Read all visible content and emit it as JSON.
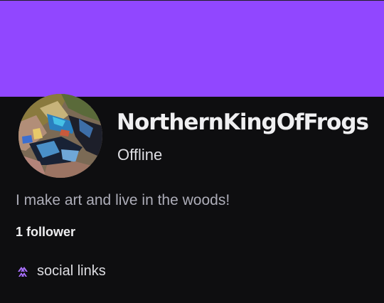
{
  "profile": {
    "username": "NorthernKingOfFrogs",
    "status": "Offline",
    "bio": "I make art and live in the woods!",
    "followers": "1 follower",
    "social_links_label": "social links",
    "avatar_icon": "profile-avatar-artwork",
    "social_icon": "double-chevron-up-icon"
  },
  "colors": {
    "banner": "#9147ff",
    "background": "#0e0e10",
    "accent": "#a970ff"
  }
}
